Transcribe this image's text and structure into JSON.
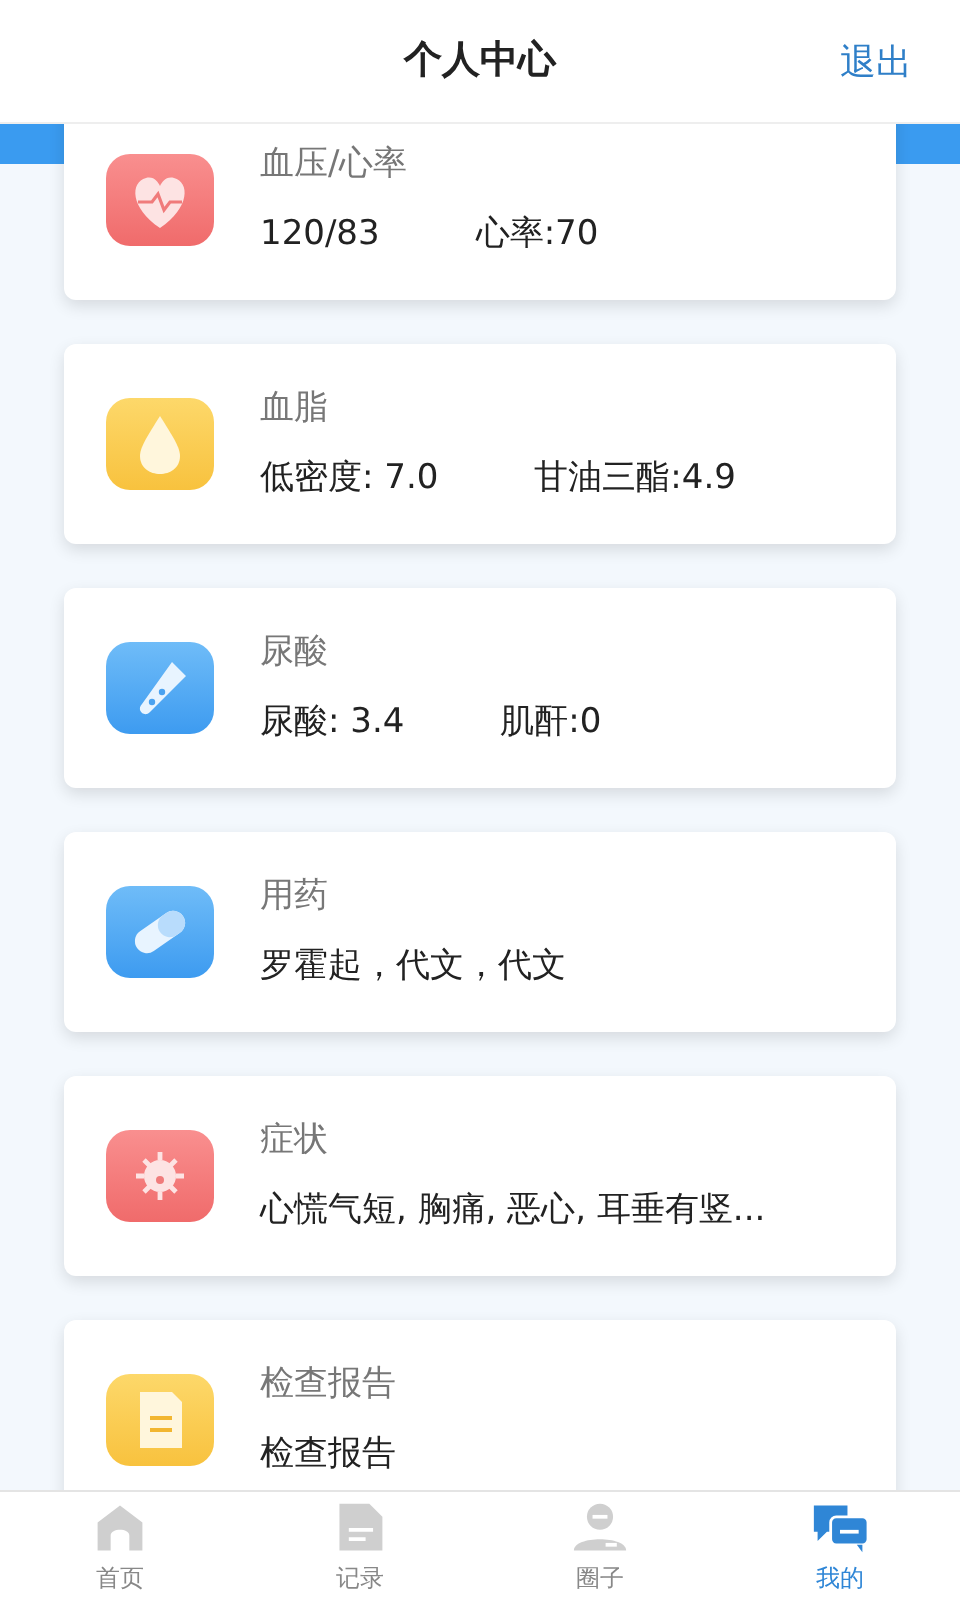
{
  "header": {
    "title": "个人中心",
    "action": "退出"
  },
  "records": [
    {
      "title": "血压/心率",
      "values": [
        "120/83",
        "心率:70"
      ]
    },
    {
      "title": "血脂",
      "values": [
        "低密度: 7.0",
        "甘油三酯:4.9"
      ]
    },
    {
      "title": "尿酸",
      "values": [
        "尿酸: 3.4",
        "肌酐:0"
      ]
    },
    {
      "title": "用药",
      "values": [
        "罗霍起，代文，代文"
      ]
    },
    {
      "title": "症状",
      "values": [
        "心慌气短, 胸痛, 恶心, 耳垂有竖..."
      ]
    },
    {
      "title": "检查报告",
      "values": [
        "检查报告"
      ]
    }
  ],
  "tab_bar": [
    {
      "label": "首页",
      "selected": false
    },
    {
      "label": "记录",
      "selected": false
    },
    {
      "label": "圈子",
      "selected": false
    },
    {
      "label": "我的",
      "selected": true
    }
  ]
}
